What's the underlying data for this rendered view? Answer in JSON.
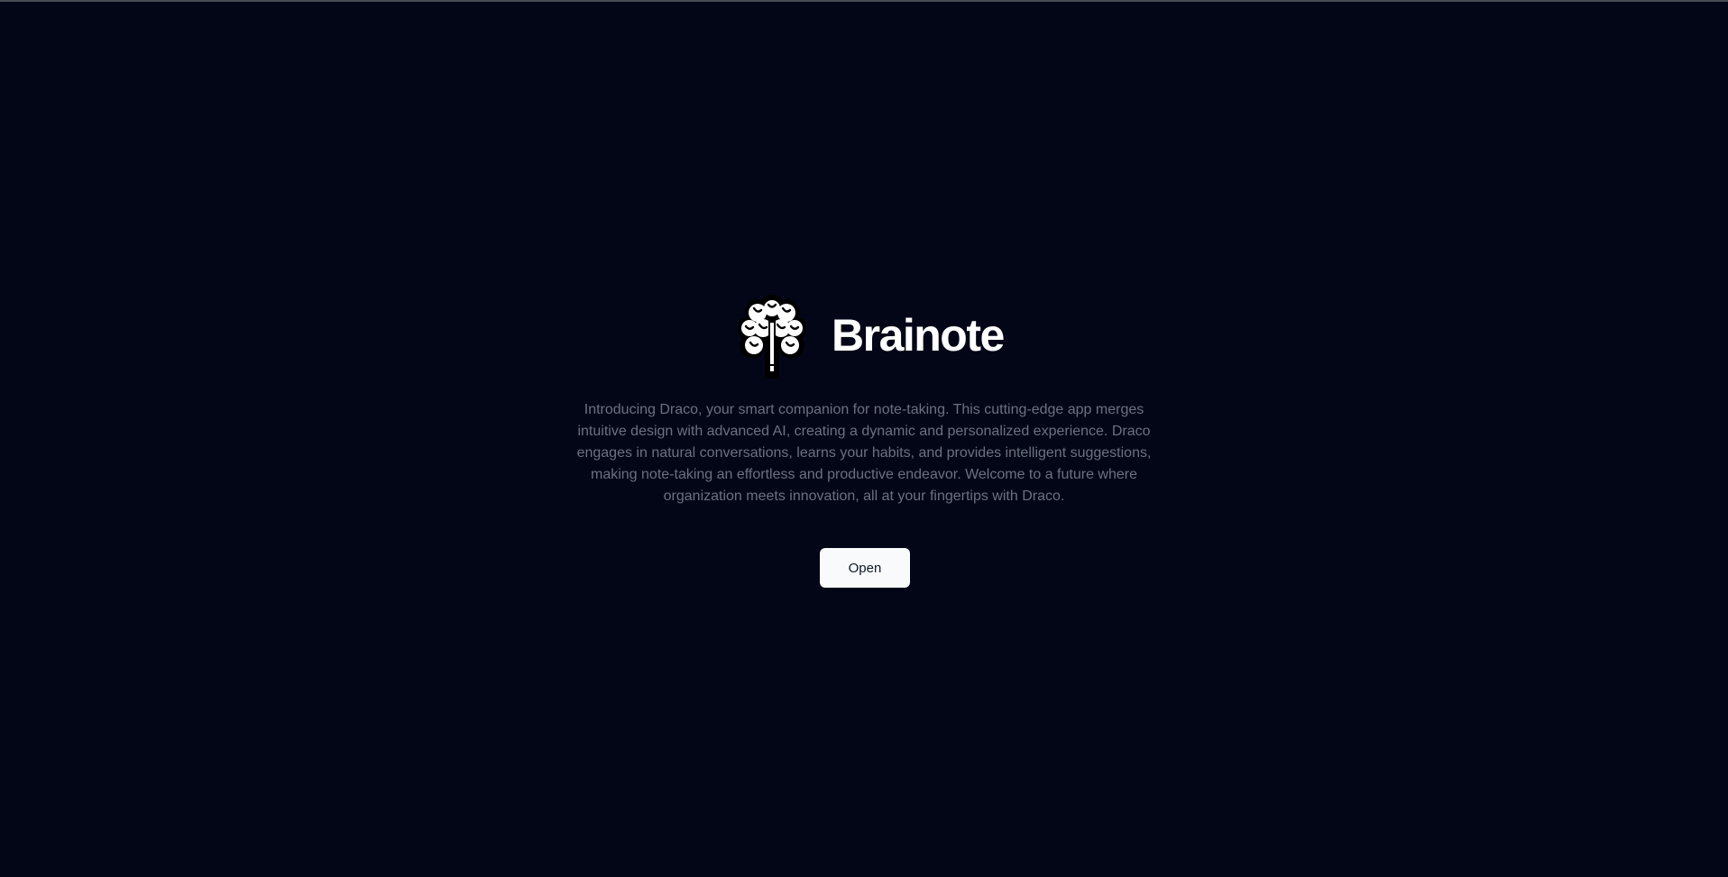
{
  "app": {
    "name": "Brainote",
    "logo_icon": "brain-pencil-icon"
  },
  "hero": {
    "description": "Introducing Draco, your smart companion for note-taking. This cutting-edge app merges intuitive design with advanced AI, creating a dynamic and personalized experience. Draco engages in natural conversations, learns your habits, and provides intelligent suggestions, making note-taking an effortless and productive endeavor. Welcome to a future where organization meets innovation, all at your fingertips with Draco.",
    "open_label": "Open"
  },
  "colors": {
    "background": "#030617",
    "title": "#ffffff",
    "description": "#6b7180",
    "button_bg": "#f8fafc",
    "button_text": "#0f172a"
  }
}
